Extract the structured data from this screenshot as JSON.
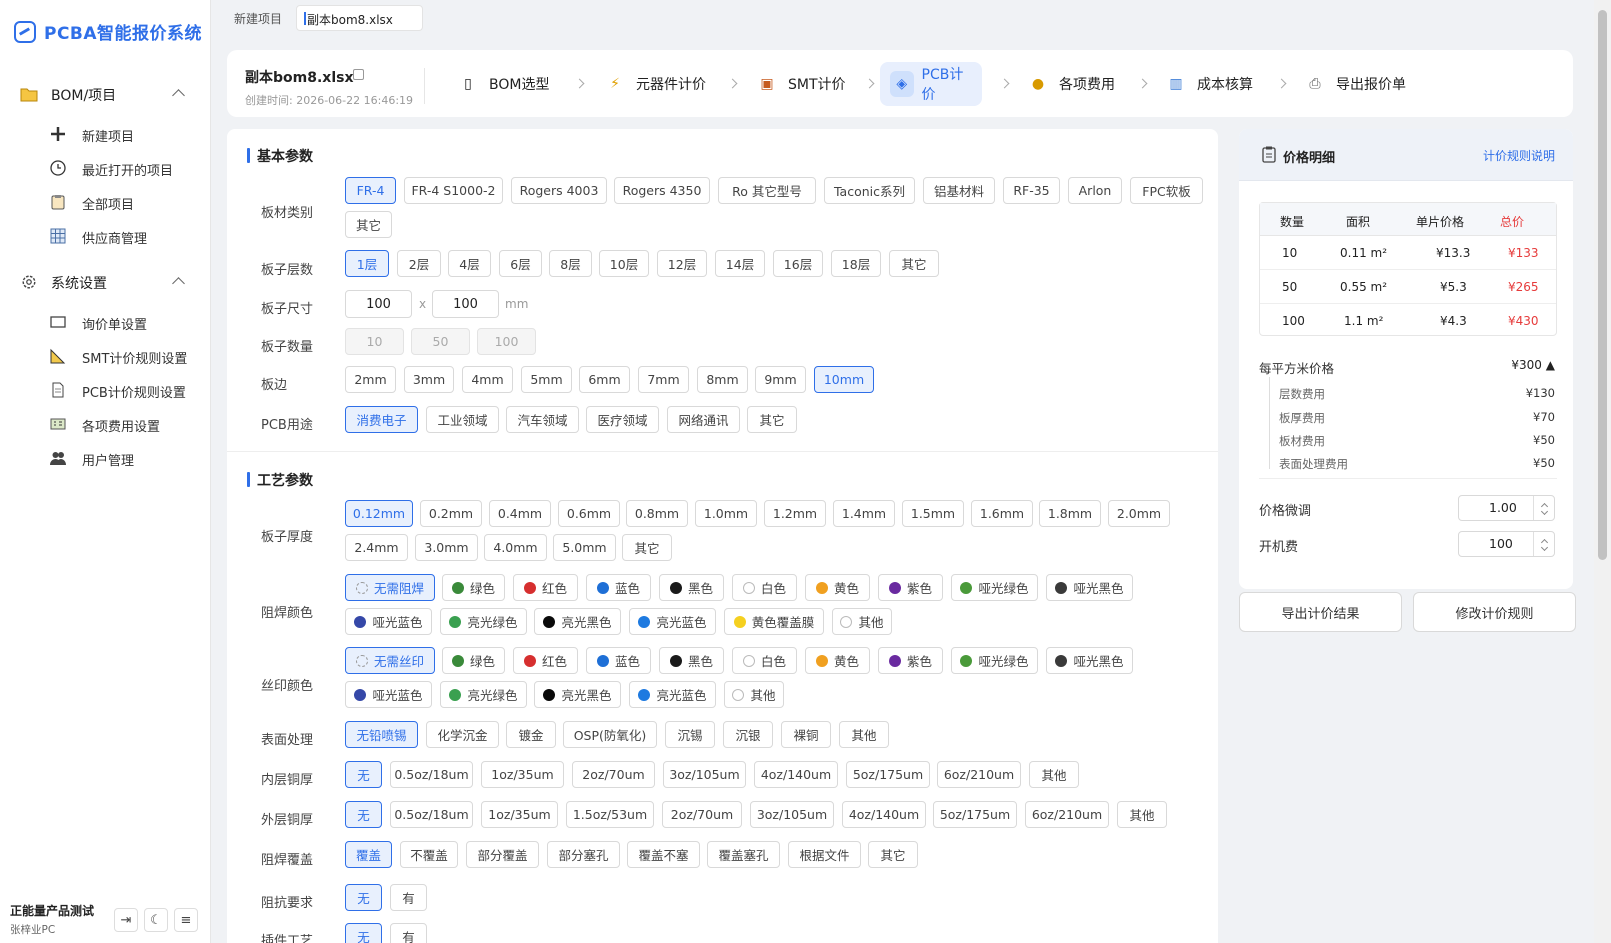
{
  "app": {
    "title": "PCBA智能报价系统"
  },
  "sidebar": {
    "groups": [
      {
        "label": "BOM/项目",
        "icon": "folder-icon",
        "items": [
          {
            "label": "新建项目",
            "icon": "plus-icon"
          },
          {
            "label": "最近打开的项目",
            "icon": "clock-icon"
          },
          {
            "label": "全部项目",
            "icon": "clipboard-icon"
          },
          {
            "label": "供应商管理",
            "icon": "grid-icon"
          }
        ]
      },
      {
        "label": "系统设置",
        "icon": "gear-icon",
        "items": [
          {
            "label": "询价单设置",
            "icon": "monitor-icon"
          },
          {
            "label": "SMT计价规则设置",
            "icon": "ruler-icon"
          },
          {
            "label": "PCB计价规则设置",
            "icon": "document-icon"
          },
          {
            "label": "各项费用设置",
            "icon": "calculator-icon"
          },
          {
            "label": "用户管理",
            "icon": "users-icon"
          }
        ]
      }
    ],
    "user": {
      "org": "正能量产品测试",
      "name": "张梓业PC"
    }
  },
  "tabs": [
    {
      "label": "新建项目"
    },
    {
      "label": "副本bom8.xlsx"
    }
  ],
  "header": {
    "file_name": "副本bom8.xlsx",
    "created": "创建时间: 2026-06-22 16:46:19",
    "steps": [
      {
        "label": "BOM选型",
        "icon": "document-icon"
      },
      {
        "label": "元器件计价",
        "icon": "lightning-icon"
      },
      {
        "label": "SMT计价",
        "icon": "factory-icon"
      },
      {
        "label": "PCB计价",
        "icon": "chip-icon"
      },
      {
        "label": "各项费用",
        "icon": "moneybag-icon"
      },
      {
        "label": "成本核算",
        "icon": "barchart-icon"
      },
      {
        "label": "导出报价单",
        "icon": "printer-icon"
      }
    ]
  },
  "basic": {
    "title": "基本参数",
    "material": {
      "label": "板材类别",
      "options": [
        "FR-4",
        "FR-4 S1000-2",
        "Rogers 4003",
        "Rogers 4350",
        "Ro 其它型号",
        "Taconic系列",
        "铝基材料",
        "RF-35",
        "Arlon",
        "FPC软板",
        "其它"
      ]
    },
    "layers": {
      "label": "板子层数",
      "options": [
        "1层",
        "2层",
        "4层",
        "6层",
        "8层",
        "10层",
        "12层",
        "14层",
        "16层",
        "18层",
        "其它"
      ]
    },
    "size": {
      "label": "板子尺寸",
      "w": "100",
      "h": "100",
      "x": "x",
      "unit": "mm"
    },
    "qty": {
      "label": "板子数量",
      "options": [
        "10",
        "50",
        "100"
      ]
    },
    "edge": {
      "label": "板边",
      "options": [
        "2mm",
        "3mm",
        "4mm",
        "5mm",
        "6mm",
        "7mm",
        "8mm",
        "9mm",
        "10mm"
      ]
    },
    "usage": {
      "label": "PCB用途",
      "options": [
        "消费电子",
        "工业领域",
        "汽车领域",
        "医疗领域",
        "网络通讯",
        "其它"
      ]
    }
  },
  "process": {
    "title": "工艺参数",
    "thickness": {
      "label": "板子厚度",
      "options": [
        "0.12mm",
        "0.2mm",
        "0.4mm",
        "0.6mm",
        "0.8mm",
        "1.0mm",
        "1.2mm",
        "1.4mm",
        "1.5mm",
        "1.6mm",
        "1.8mm",
        "2.0mm",
        "2.4mm",
        "3.0mm",
        "4.0mm",
        "5.0mm",
        "其它"
      ]
    },
    "mask": {
      "label": "阻焊颜色",
      "options": [
        "无需阻焊",
        "绿色",
        "红色",
        "蓝色",
        "黑色",
        "白色",
        "黄色",
        "紫色",
        "哑光绿色",
        "哑光黑色",
        "哑光蓝色",
        "亮光绿色",
        "亮光黑色",
        "亮光蓝色",
        "黄色覆盖膜",
        "其他"
      ]
    },
    "silk": {
      "label": "丝印颜色",
      "options": [
        "无需丝印",
        "绿色",
        "红色",
        "蓝色",
        "黑色",
        "白色",
        "黄色",
        "紫色",
        "哑光绿色",
        "哑光黑色",
        "哑光蓝色",
        "亮光绿色",
        "亮光黑色",
        "亮光蓝色",
        "其他"
      ]
    },
    "surface": {
      "label": "表面处理",
      "options": [
        "无铅喷锡",
        "化学沉金",
        "镀金",
        "OSP(防氧化)",
        "沉锡",
        "沉银",
        "裸铜",
        "其他"
      ]
    },
    "inner": {
      "label": "内层铜厚",
      "options": [
        "无",
        "0.5oz/18um",
        "1oz/35um",
        "2oz/70um",
        "3oz/105um",
        "4oz/140um",
        "5oz/175um",
        "6oz/210um",
        "其他"
      ]
    },
    "outer": {
      "label": "外层铜厚",
      "options": [
        "无",
        "0.5oz/18um",
        "1oz/35um",
        "1.5oz/53um",
        "2oz/70um",
        "3oz/105um",
        "4oz/140um",
        "5oz/175um",
        "6oz/210um",
        "其他"
      ]
    },
    "cover": {
      "label": "阻焊覆盖",
      "options": [
        "覆盖",
        "不覆盖",
        "部分覆盖",
        "部分塞孔",
        "覆盖不塞",
        "覆盖塞孔",
        "根据文件",
        "其它"
      ]
    },
    "impedance": {
      "label": "阻抗要求",
      "options": [
        "无",
        "有"
      ]
    },
    "plugin": {
      "label": "插件工艺",
      "options": [
        "无",
        "有"
      ]
    }
  },
  "colors": {
    "none": "#ffffff",
    "green": "#3a8a3a",
    "red": "#d62f2f",
    "blue": "#1e6fd6",
    "black": "#1a1a1a",
    "white": "#ffffff",
    "yellow": "#f0a020",
    "purple": "#6a2aa0",
    "matte_green": "#4a9a3a",
    "matte_black": "#3a3a3a",
    "matte_blue": "#3548a8",
    "bright_green": "#3aa050",
    "bright_black": "#0a0a0a",
    "bright_blue": "#1e7ae0",
    "yellow_film": "#f5d020",
    "accent": "#2f6fe8"
  },
  "price": {
    "title": "价格明细",
    "rule_link": "计价规则说明",
    "columns": [
      "数量",
      "面积",
      "单片价格",
      "总价"
    ],
    "rows": [
      {
        "qty": "10",
        "area": "0.11 m²",
        "unit": "¥13.3",
        "total": "¥133"
      },
      {
        "qty": "50",
        "area": "0.55 m²",
        "unit": "¥5.3",
        "total": "¥265"
      },
      {
        "qty": "100",
        "area": "1.1 m²",
        "unit": "¥4.3",
        "total": "¥430"
      }
    ],
    "per_sqm_label": "每平方米价格",
    "per_sqm": "¥300 ▲",
    "breakdown": [
      {
        "label": "层数费用",
        "value": "¥130"
      },
      {
        "label": "板厚费用",
        "value": "¥70"
      },
      {
        "label": "板材费用",
        "value": "¥50"
      },
      {
        "label": "表面处理费用",
        "value": "¥50"
      }
    ],
    "adjust_label": "价格微调",
    "adjust": "1.00",
    "setup_label": "开机费",
    "setup": "100",
    "export_btn": "导出计价结果",
    "modify_btn": "修改计价规则"
  }
}
